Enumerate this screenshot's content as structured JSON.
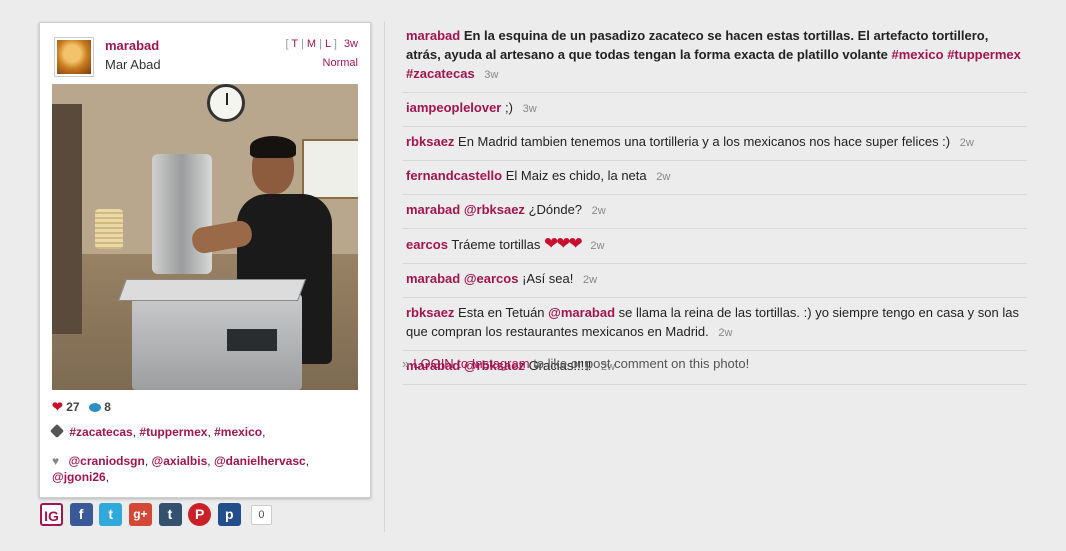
{
  "post": {
    "username": "marabad",
    "full_name": "Mar Abad",
    "sizes": {
      "open": "[",
      "t": "T",
      "sep1": "|",
      "m": "M",
      "sep2": "|",
      "l": "L",
      "close": "]"
    },
    "age": "3w",
    "filter": "Normal",
    "likes": "27",
    "comments_count": "8",
    "tags": [
      "#zacatecas",
      "#tuppermex",
      "#mexico"
    ],
    "liked_by": [
      "@craniodsgn",
      "@axialbis",
      "@danielhervasc",
      "@jgoni26"
    ]
  },
  "share": {
    "icons": [
      "instagram-icon",
      "facebook-icon",
      "twitter-icon",
      "google-plus-icon",
      "tumblr-icon",
      "pinterest-icon",
      "pinterest-alt-icon"
    ],
    "labels": {
      "ig": "IG",
      "fb": "f",
      "tw": "t",
      "gp": "g+",
      "tu": "t",
      "pi": "P",
      "pp": "p"
    },
    "count": "0"
  },
  "comments": [
    {
      "user": "marabad",
      "text": "En la esquina de un pasadizo zacateco se hacen estas tortillas. El artefacto tortillero, atrás, ayuda al artesano a que todas tengan la forma exacta de platillo volante",
      "tags": [
        "#mexico",
        "#tuppermex",
        "#zacatecas"
      ],
      "time": "3w"
    },
    {
      "user": "iampeoplelover",
      "text": ";)",
      "time": "3w"
    },
    {
      "user": "rbksaez",
      "text": "En Madrid tambien tenemos una tortilleria y a los mexicanos nos hace super felices :)",
      "time": "2w"
    },
    {
      "user": "fernandcastello",
      "text": "El Maiz es chido, la neta",
      "time": "2w"
    },
    {
      "user": "marabad",
      "mention": "@rbksaez",
      "text": "¿Dónde?",
      "time": "2w"
    },
    {
      "user": "earcos",
      "text": "Tráeme tortillas",
      "hearts": "❤❤❤",
      "time": "2w"
    },
    {
      "user": "marabad",
      "mention": "@earcos",
      "text": "¡Así sea!",
      "time": "2w"
    },
    {
      "user": "rbksaez",
      "text_a": "Esta en Tetuán",
      "mention": "@marabad",
      "text_b": "se llama la reina de las tortillas. :) yo siempre tengo en casa y son las que compran los restaurantes mexicanos en Madrid.",
      "time": "2w"
    },
    {
      "user": "marabad",
      "mention": "@rbksaez",
      "text": "Gracias!!!!!",
      "time": "2w"
    }
  ],
  "login": {
    "arrow": "»",
    "link": "LOGIN to Instagram",
    "rest": "to like or post comment on this photo!"
  }
}
